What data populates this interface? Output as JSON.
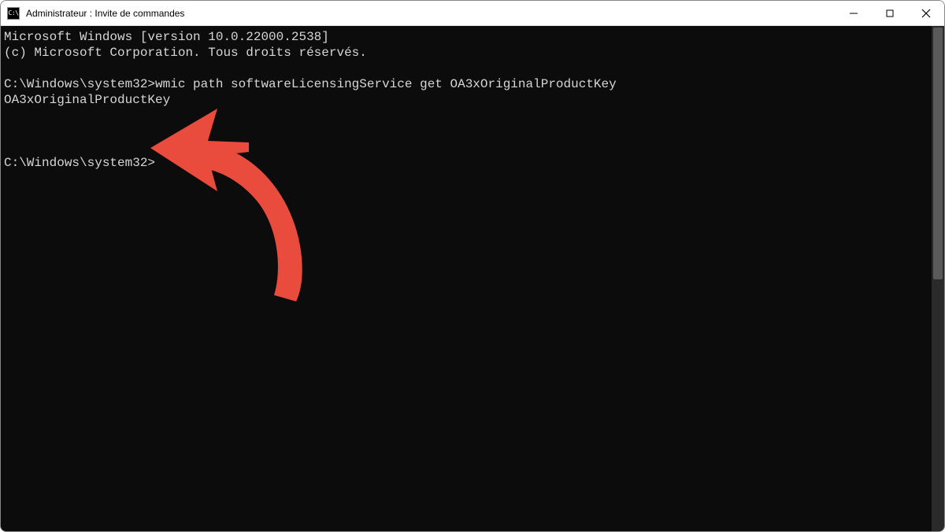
{
  "window": {
    "title": "Administrateur : Invite de commandes",
    "icon_label": "cmd-icon"
  },
  "terminal": {
    "lines": [
      "Microsoft Windows [version 10.0.22000.2538]",
      "(c) Microsoft Corporation. Tous droits réservés.",
      "",
      "C:\\Windows\\system32>wmic path softwareLicensingService get OA3xOriginalProductKey",
      "OA3xOriginalProductKey",
      "",
      "",
      "",
      "C:\\Windows\\system32>"
    ]
  },
  "annotation": {
    "color": "#E94B3C"
  },
  "win_controls": {
    "minimize": "minimize",
    "maximize": "maximize",
    "close": "close"
  }
}
